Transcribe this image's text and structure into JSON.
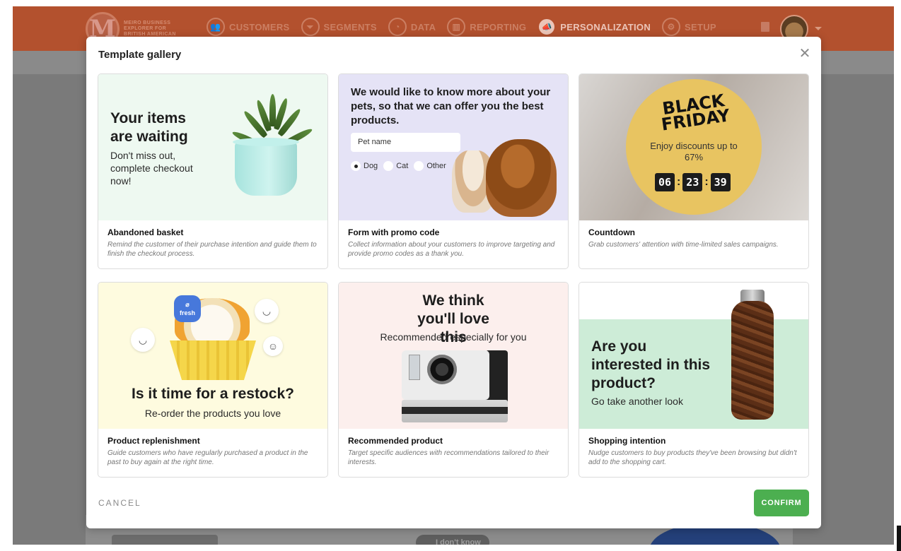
{
  "app": {
    "brand_letter": "M",
    "brand_lines": [
      "MEIRO BUSINESS",
      "EXPLORER FOR",
      "BRITISH AMERICAN"
    ],
    "nav": [
      {
        "label": "CUSTOMERS",
        "icon": "customers-icon",
        "glyph": "👥"
      },
      {
        "label": "SEGMENTS",
        "icon": "segments-icon",
        "glyph": "⏷"
      },
      {
        "label": "DATA",
        "icon": "data-icon",
        "glyph": "◔"
      },
      {
        "label": "REPORTING",
        "icon": "reporting-icon",
        "glyph": "▥"
      },
      {
        "label": "PERSONALIZATION",
        "icon": "personalization-icon",
        "glyph": "📣"
      },
      {
        "label": "SETUP",
        "icon": "setup-icon",
        "glyph": "⚙"
      }
    ],
    "bg_pill_label": "I don't know"
  },
  "modal": {
    "title": "Template gallery",
    "close_glyph": "✕",
    "cancel_label": "CANCEL",
    "confirm_label": "CONFIRM",
    "templates": [
      {
        "name": "Abandoned basket",
        "description": "Remind the customer of their purchase intention and guide them to finish the checkout process.",
        "preview": {
          "headline": "Your items are waiting",
          "subtext": "Don't miss out, complete checkout now!"
        }
      },
      {
        "name": "Form with promo code",
        "description": "Collect information about your customers to improve targeting and provide promo codes as a thank you.",
        "preview": {
          "headline": "We would like to know more about your pets, so that we can offer you the best products.",
          "input_value": "Pet name",
          "options": [
            "Dog",
            "Cat",
            "Other"
          ],
          "selected_option": "Dog"
        }
      },
      {
        "name": "Countdown",
        "description": "Grab customers' attention with time-limited sales campaigns.",
        "preview": {
          "headline": "BLACK FRIDAY",
          "subtext": "Enjoy discounts up to 67%",
          "hours": "06",
          "minutes": "23",
          "seconds": "39"
        }
      },
      {
        "name": "Product replenishment",
        "description": "Guide customers who have regularly purchased a product in the past to buy again at the right time.",
        "preview": {
          "headline": "Is it time for a restock?",
          "subtext": "Re-order the products you love",
          "badge": "fresh"
        }
      },
      {
        "name": "Recommended product",
        "description": "Target specific audiences with recommendations tailored to their interests.",
        "preview": {
          "headline": "We think you'll love this",
          "subtext": "Recommended especially for you"
        }
      },
      {
        "name": "Shopping intention",
        "description": "Nudge customers to buy products they've been browsing but didn't add to the shopping cart.",
        "preview": {
          "headline": "Are you interested in this product?",
          "subtext": "Go take another look"
        }
      }
    ]
  },
  "colors": {
    "topbar": "#b3512e",
    "confirm": "#4caf50",
    "card1_bg": "#eef9f1",
    "card2_bg": "#e5e3f6",
    "card3_circle": "#e8c461",
    "card4_bg": "#fefbdf",
    "card5_bg": "#fcefed",
    "card6_band": "#cdecd7",
    "fresh_badge": "#4778db"
  }
}
